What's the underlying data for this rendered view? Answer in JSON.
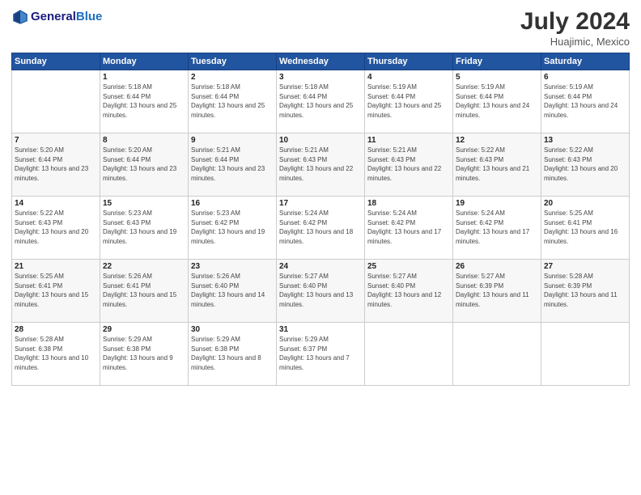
{
  "header": {
    "logo_line1": "General",
    "logo_line2": "Blue",
    "month": "July 2024",
    "location": "Huajimic, Mexico"
  },
  "days_of_week": [
    "Sunday",
    "Monday",
    "Tuesday",
    "Wednesday",
    "Thursday",
    "Friday",
    "Saturday"
  ],
  "weeks": [
    [
      {
        "day": "",
        "sunrise": "",
        "sunset": "",
        "daylight": ""
      },
      {
        "day": "1",
        "sunrise": "Sunrise: 5:18 AM",
        "sunset": "Sunset: 6:44 PM",
        "daylight": "Daylight: 13 hours and 25 minutes."
      },
      {
        "day": "2",
        "sunrise": "Sunrise: 5:18 AM",
        "sunset": "Sunset: 6:44 PM",
        "daylight": "Daylight: 13 hours and 25 minutes."
      },
      {
        "day": "3",
        "sunrise": "Sunrise: 5:18 AM",
        "sunset": "Sunset: 6:44 PM",
        "daylight": "Daylight: 13 hours and 25 minutes."
      },
      {
        "day": "4",
        "sunrise": "Sunrise: 5:19 AM",
        "sunset": "Sunset: 6:44 PM",
        "daylight": "Daylight: 13 hours and 25 minutes."
      },
      {
        "day": "5",
        "sunrise": "Sunrise: 5:19 AM",
        "sunset": "Sunset: 6:44 PM",
        "daylight": "Daylight: 13 hours and 24 minutes."
      },
      {
        "day": "6",
        "sunrise": "Sunrise: 5:19 AM",
        "sunset": "Sunset: 6:44 PM",
        "daylight": "Daylight: 13 hours and 24 minutes."
      }
    ],
    [
      {
        "day": "7",
        "sunrise": "Sunrise: 5:20 AM",
        "sunset": "Sunset: 6:44 PM",
        "daylight": "Daylight: 13 hours and 23 minutes."
      },
      {
        "day": "8",
        "sunrise": "Sunrise: 5:20 AM",
        "sunset": "Sunset: 6:44 PM",
        "daylight": "Daylight: 13 hours and 23 minutes."
      },
      {
        "day": "9",
        "sunrise": "Sunrise: 5:21 AM",
        "sunset": "Sunset: 6:44 PM",
        "daylight": "Daylight: 13 hours and 23 minutes."
      },
      {
        "day": "10",
        "sunrise": "Sunrise: 5:21 AM",
        "sunset": "Sunset: 6:43 PM",
        "daylight": "Daylight: 13 hours and 22 minutes."
      },
      {
        "day": "11",
        "sunrise": "Sunrise: 5:21 AM",
        "sunset": "Sunset: 6:43 PM",
        "daylight": "Daylight: 13 hours and 22 minutes."
      },
      {
        "day": "12",
        "sunrise": "Sunrise: 5:22 AM",
        "sunset": "Sunset: 6:43 PM",
        "daylight": "Daylight: 13 hours and 21 minutes."
      },
      {
        "day": "13",
        "sunrise": "Sunrise: 5:22 AM",
        "sunset": "Sunset: 6:43 PM",
        "daylight": "Daylight: 13 hours and 20 minutes."
      }
    ],
    [
      {
        "day": "14",
        "sunrise": "Sunrise: 5:22 AM",
        "sunset": "Sunset: 6:43 PM",
        "daylight": "Daylight: 13 hours and 20 minutes."
      },
      {
        "day": "15",
        "sunrise": "Sunrise: 5:23 AM",
        "sunset": "Sunset: 6:43 PM",
        "daylight": "Daylight: 13 hours and 19 minutes."
      },
      {
        "day": "16",
        "sunrise": "Sunrise: 5:23 AM",
        "sunset": "Sunset: 6:42 PM",
        "daylight": "Daylight: 13 hours and 19 minutes."
      },
      {
        "day": "17",
        "sunrise": "Sunrise: 5:24 AM",
        "sunset": "Sunset: 6:42 PM",
        "daylight": "Daylight: 13 hours and 18 minutes."
      },
      {
        "day": "18",
        "sunrise": "Sunrise: 5:24 AM",
        "sunset": "Sunset: 6:42 PM",
        "daylight": "Daylight: 13 hours and 17 minutes."
      },
      {
        "day": "19",
        "sunrise": "Sunrise: 5:24 AM",
        "sunset": "Sunset: 6:42 PM",
        "daylight": "Daylight: 13 hours and 17 minutes."
      },
      {
        "day": "20",
        "sunrise": "Sunrise: 5:25 AM",
        "sunset": "Sunset: 6:41 PM",
        "daylight": "Daylight: 13 hours and 16 minutes."
      }
    ],
    [
      {
        "day": "21",
        "sunrise": "Sunrise: 5:25 AM",
        "sunset": "Sunset: 6:41 PM",
        "daylight": "Daylight: 13 hours and 15 minutes."
      },
      {
        "day": "22",
        "sunrise": "Sunrise: 5:26 AM",
        "sunset": "Sunset: 6:41 PM",
        "daylight": "Daylight: 13 hours and 15 minutes."
      },
      {
        "day": "23",
        "sunrise": "Sunrise: 5:26 AM",
        "sunset": "Sunset: 6:40 PM",
        "daylight": "Daylight: 13 hours and 14 minutes."
      },
      {
        "day": "24",
        "sunrise": "Sunrise: 5:27 AM",
        "sunset": "Sunset: 6:40 PM",
        "daylight": "Daylight: 13 hours and 13 minutes."
      },
      {
        "day": "25",
        "sunrise": "Sunrise: 5:27 AM",
        "sunset": "Sunset: 6:40 PM",
        "daylight": "Daylight: 13 hours and 12 minutes."
      },
      {
        "day": "26",
        "sunrise": "Sunrise: 5:27 AM",
        "sunset": "Sunset: 6:39 PM",
        "daylight": "Daylight: 13 hours and 11 minutes."
      },
      {
        "day": "27",
        "sunrise": "Sunrise: 5:28 AM",
        "sunset": "Sunset: 6:39 PM",
        "daylight": "Daylight: 13 hours and 11 minutes."
      }
    ],
    [
      {
        "day": "28",
        "sunrise": "Sunrise: 5:28 AM",
        "sunset": "Sunset: 6:38 PM",
        "daylight": "Daylight: 13 hours and 10 minutes."
      },
      {
        "day": "29",
        "sunrise": "Sunrise: 5:29 AM",
        "sunset": "Sunset: 6:38 PM",
        "daylight": "Daylight: 13 hours and 9 minutes."
      },
      {
        "day": "30",
        "sunrise": "Sunrise: 5:29 AM",
        "sunset": "Sunset: 6:38 PM",
        "daylight": "Daylight: 13 hours and 8 minutes."
      },
      {
        "day": "31",
        "sunrise": "Sunrise: 5:29 AM",
        "sunset": "Sunset: 6:37 PM",
        "daylight": "Daylight: 13 hours and 7 minutes."
      },
      {
        "day": "",
        "sunrise": "",
        "sunset": "",
        "daylight": ""
      },
      {
        "day": "",
        "sunrise": "",
        "sunset": "",
        "daylight": ""
      },
      {
        "day": "",
        "sunrise": "",
        "sunset": "",
        "daylight": ""
      }
    ]
  ]
}
